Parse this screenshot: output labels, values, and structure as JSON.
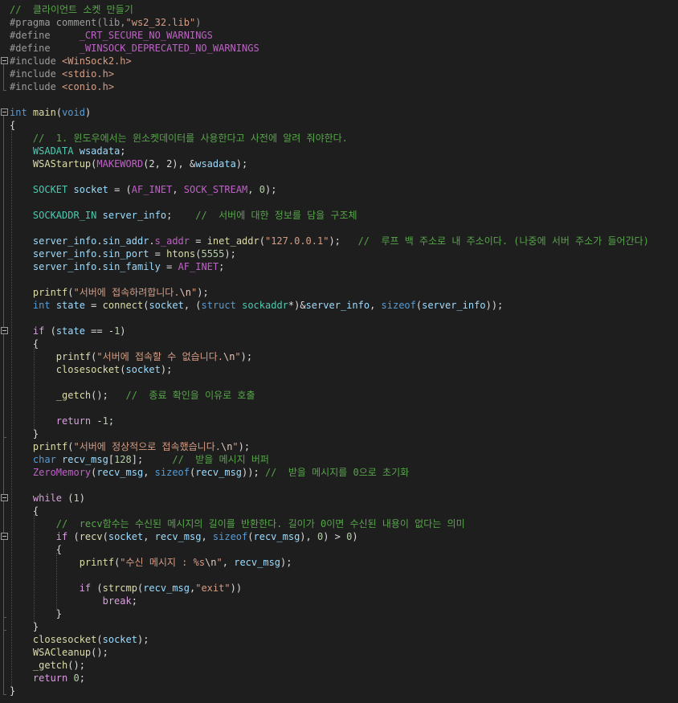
{
  "editor": {
    "theme_colors": {
      "background": "#1e1e1e",
      "comment": "#57a64a",
      "preprocessor": "#9b9b9b",
      "macro": "#bd63c5",
      "string": "#d69d85",
      "keyword": "#569cd6",
      "control": "#d8a0df",
      "type": "#4ec9b0",
      "function": "#dcdcaa",
      "variable": "#9cdcfe",
      "number": "#b5cea8",
      "plain": "#dcdcdc"
    },
    "lines": [
      {
        "tokens": [
          [
            "comment",
            "//  클라이언트 소켓 만들기"
          ]
        ]
      },
      {
        "tokens": [
          [
            "pre",
            "#pragma comment(lib,"
          ],
          [
            "string",
            "\"ws2_32.lib\""
          ],
          [
            "pre",
            ")"
          ]
        ]
      },
      {
        "tokens": [
          [
            "pre",
            "#define     "
          ],
          [
            "macro",
            "_CRT_SECURE_NO_WARNINGS"
          ]
        ]
      },
      {
        "tokens": [
          [
            "pre",
            "#define     "
          ],
          [
            "macro",
            "_WINSOCK_DEPRECATED_NO_WARNINGS"
          ]
        ]
      },
      {
        "tokens": [
          [
            "pre",
            "#include "
          ],
          [
            "string",
            "<WinSock2.h>"
          ]
        ]
      },
      {
        "tokens": [
          [
            "pre",
            "#include "
          ],
          [
            "string",
            "<stdio.h>"
          ]
        ]
      },
      {
        "tokens": [
          [
            "pre",
            "#include "
          ],
          [
            "string",
            "<conio.h>"
          ]
        ]
      },
      {
        "tokens": []
      },
      {
        "tokens": [
          [
            "keyword",
            "int"
          ],
          [
            "plain",
            " "
          ],
          [
            "func",
            "main"
          ],
          [
            "plain",
            "("
          ],
          [
            "keyword",
            "void"
          ],
          [
            "plain",
            ")"
          ]
        ]
      },
      {
        "tokens": [
          [
            "plain",
            "{"
          ]
        ]
      },
      {
        "tokens": [
          [
            "plain",
            "    "
          ],
          [
            "comment",
            "//  1. 윈도우에서는 윈소켓데이터를 사용한다고 사전에 알려 줘야한다."
          ]
        ]
      },
      {
        "tokens": [
          [
            "plain",
            "    "
          ],
          [
            "type",
            "WSADATA"
          ],
          [
            "plain",
            " "
          ],
          [
            "var",
            "wsadata"
          ],
          [
            "plain",
            ";"
          ]
        ]
      },
      {
        "tokens": [
          [
            "plain",
            "    "
          ],
          [
            "func",
            "WSAStartup"
          ],
          [
            "plain",
            "("
          ],
          [
            "macro",
            "MAKEWORD"
          ],
          [
            "plain",
            "(2, 2), &"
          ],
          [
            "var",
            "wsadata"
          ],
          [
            "plain",
            ");"
          ]
        ]
      },
      {
        "tokens": []
      },
      {
        "tokens": [
          [
            "plain",
            "    "
          ],
          [
            "type",
            "SOCKET"
          ],
          [
            "plain",
            " "
          ],
          [
            "var",
            "socket"
          ],
          [
            "plain",
            " = ("
          ],
          [
            "macro",
            "AF_INET"
          ],
          [
            "plain",
            ", "
          ],
          [
            "macro",
            "SOCK_STREAM"
          ],
          [
            "plain",
            ", "
          ],
          [
            "num",
            "0"
          ],
          [
            "plain",
            ");"
          ]
        ]
      },
      {
        "tokens": []
      },
      {
        "tokens": [
          [
            "plain",
            "    "
          ],
          [
            "type",
            "SOCKADDR_IN"
          ],
          [
            "plain",
            " "
          ],
          [
            "var",
            "server_info"
          ],
          [
            "plain",
            ";    "
          ],
          [
            "comment",
            "//  서버에 대한 정보를 담을 구조체"
          ]
        ]
      },
      {
        "tokens": []
      },
      {
        "tokens": [
          [
            "plain",
            "    "
          ],
          [
            "var",
            "server_info"
          ],
          [
            "plain",
            "."
          ],
          [
            "var",
            "sin_addr"
          ],
          [
            "plain",
            "."
          ],
          [
            "macro",
            "s_addr"
          ],
          [
            "plain",
            " = "
          ],
          [
            "func",
            "inet_addr"
          ],
          [
            "plain",
            "("
          ],
          [
            "string",
            "\"127.0.0.1\""
          ],
          [
            "plain",
            ");   "
          ],
          [
            "comment",
            "//  루프 백 주소로 내 주소이다. (나중에 서버 주소가 들어간다)"
          ]
        ]
      },
      {
        "tokens": [
          [
            "plain",
            "    "
          ],
          [
            "var",
            "server_info"
          ],
          [
            "plain",
            "."
          ],
          [
            "var",
            "sin_port"
          ],
          [
            "plain",
            " = "
          ],
          [
            "func",
            "htons"
          ],
          [
            "plain",
            "("
          ],
          [
            "num",
            "5555"
          ],
          [
            "plain",
            ");"
          ]
        ]
      },
      {
        "tokens": [
          [
            "plain",
            "    "
          ],
          [
            "var",
            "server_info"
          ],
          [
            "plain",
            "."
          ],
          [
            "var",
            "sin_family"
          ],
          [
            "plain",
            " = "
          ],
          [
            "macro",
            "AF_INET"
          ],
          [
            "plain",
            ";"
          ]
        ]
      },
      {
        "tokens": []
      },
      {
        "tokens": [
          [
            "plain",
            "    "
          ],
          [
            "func",
            "printf"
          ],
          [
            "plain",
            "("
          ],
          [
            "string",
            "\"서버에 접속하려합니다."
          ],
          [
            "esc",
            "\\n"
          ],
          [
            "string",
            "\""
          ],
          [
            "plain",
            ");"
          ]
        ]
      },
      {
        "tokens": [
          [
            "plain",
            "    "
          ],
          [
            "keyword",
            "int"
          ],
          [
            "plain",
            " "
          ],
          [
            "var",
            "state"
          ],
          [
            "plain",
            " = "
          ],
          [
            "func",
            "connect"
          ],
          [
            "plain",
            "("
          ],
          [
            "var",
            "socket"
          ],
          [
            "plain",
            ", ("
          ],
          [
            "keyword",
            "struct"
          ],
          [
            "plain",
            " "
          ],
          [
            "type",
            "sockaddr"
          ],
          [
            "plain",
            "*)&"
          ],
          [
            "var",
            "server_info"
          ],
          [
            "plain",
            ", "
          ],
          [
            "keyword",
            "sizeof"
          ],
          [
            "plain",
            "("
          ],
          [
            "var",
            "server_info"
          ],
          [
            "plain",
            "));"
          ]
        ]
      },
      {
        "tokens": []
      },
      {
        "tokens": [
          [
            "plain",
            "    "
          ],
          [
            "ctrl",
            "if"
          ],
          [
            "plain",
            " ("
          ],
          [
            "var",
            "state"
          ],
          [
            "plain",
            " == -"
          ],
          [
            "num",
            "1"
          ],
          [
            "plain",
            ")"
          ]
        ]
      },
      {
        "tokens": [
          [
            "plain",
            "    {"
          ]
        ]
      },
      {
        "tokens": [
          [
            "plain",
            "        "
          ],
          [
            "func",
            "printf"
          ],
          [
            "plain",
            "("
          ],
          [
            "string",
            "\"서버에 접속할 수 없습니다."
          ],
          [
            "esc",
            "\\n"
          ],
          [
            "string",
            "\""
          ],
          [
            "plain",
            ");"
          ]
        ]
      },
      {
        "tokens": [
          [
            "plain",
            "        "
          ],
          [
            "func",
            "closesocket"
          ],
          [
            "plain",
            "("
          ],
          [
            "var",
            "socket"
          ],
          [
            "plain",
            ");"
          ]
        ]
      },
      {
        "tokens": []
      },
      {
        "tokens": [
          [
            "plain",
            "        "
          ],
          [
            "func",
            "_getch"
          ],
          [
            "plain",
            "();   "
          ],
          [
            "comment",
            "//  종료 확인을 이유로 호출"
          ]
        ]
      },
      {
        "tokens": []
      },
      {
        "tokens": [
          [
            "plain",
            "        "
          ],
          [
            "ctrl",
            "return"
          ],
          [
            "plain",
            " -"
          ],
          [
            "num",
            "1"
          ],
          [
            "plain",
            ";"
          ]
        ]
      },
      {
        "tokens": [
          [
            "plain",
            "    }"
          ]
        ]
      },
      {
        "tokens": [
          [
            "plain",
            "    "
          ],
          [
            "func",
            "printf"
          ],
          [
            "plain",
            "("
          ],
          [
            "string",
            "\"서버에 정상적으로 접속했습니다."
          ],
          [
            "esc",
            "\\n"
          ],
          [
            "string",
            "\""
          ],
          [
            "plain",
            ");"
          ]
        ]
      },
      {
        "tokens": [
          [
            "plain",
            "    "
          ],
          [
            "keyword",
            "char"
          ],
          [
            "plain",
            " "
          ],
          [
            "var",
            "recv_msg"
          ],
          [
            "plain",
            "["
          ],
          [
            "num",
            "128"
          ],
          [
            "plain",
            "];     "
          ],
          [
            "comment",
            "//  받을 메시지 버퍼"
          ]
        ]
      },
      {
        "tokens": [
          [
            "plain",
            "    "
          ],
          [
            "macro",
            "ZeroMemory"
          ],
          [
            "plain",
            "("
          ],
          [
            "var",
            "recv_msg"
          ],
          [
            "plain",
            ", "
          ],
          [
            "keyword",
            "sizeof"
          ],
          [
            "plain",
            "("
          ],
          [
            "var",
            "recv_msg"
          ],
          [
            "plain",
            ")); "
          ],
          [
            "comment",
            "//  받을 메시지를 0으로 초기화"
          ]
        ]
      },
      {
        "tokens": []
      },
      {
        "tokens": [
          [
            "plain",
            "    "
          ],
          [
            "ctrl",
            "while"
          ],
          [
            "plain",
            " ("
          ],
          [
            "num",
            "1"
          ],
          [
            "plain",
            ")"
          ]
        ]
      },
      {
        "tokens": [
          [
            "plain",
            "    {"
          ]
        ]
      },
      {
        "tokens": [
          [
            "plain",
            "        "
          ],
          [
            "comment",
            "//  recv함수는 수신된 메시지의 길이를 반환한다. 길이가 0이면 수신된 내용이 없다는 의미"
          ]
        ]
      },
      {
        "tokens": [
          [
            "plain",
            "        "
          ],
          [
            "ctrl",
            "if"
          ],
          [
            "plain",
            " ("
          ],
          [
            "func",
            "recv"
          ],
          [
            "plain",
            "("
          ],
          [
            "var",
            "socket"
          ],
          [
            "plain",
            ", "
          ],
          [
            "var",
            "recv_msg"
          ],
          [
            "plain",
            ", "
          ],
          [
            "keyword",
            "sizeof"
          ],
          [
            "plain",
            "("
          ],
          [
            "var",
            "recv_msg"
          ],
          [
            "plain",
            "), "
          ],
          [
            "num",
            "0"
          ],
          [
            "plain",
            ") > "
          ],
          [
            "num",
            "0"
          ],
          [
            "plain",
            ")"
          ]
        ]
      },
      {
        "tokens": [
          [
            "plain",
            "        {"
          ]
        ]
      },
      {
        "tokens": [
          [
            "plain",
            "            "
          ],
          [
            "func",
            "printf"
          ],
          [
            "plain",
            "("
          ],
          [
            "string",
            "\"수신 메시지 : %s"
          ],
          [
            "esc",
            "\\n"
          ],
          [
            "string",
            "\""
          ],
          [
            "plain",
            ", "
          ],
          [
            "var",
            "recv_msg"
          ],
          [
            "plain",
            ");"
          ]
        ]
      },
      {
        "tokens": []
      },
      {
        "tokens": [
          [
            "plain",
            "            "
          ],
          [
            "ctrl",
            "if"
          ],
          [
            "plain",
            " ("
          ],
          [
            "func",
            "strcmp"
          ],
          [
            "plain",
            "("
          ],
          [
            "var",
            "recv_msg"
          ],
          [
            "plain",
            ","
          ],
          [
            "string",
            "\"exit\""
          ],
          [
            "plain",
            "))"
          ]
        ]
      },
      {
        "tokens": [
          [
            "plain",
            "                "
          ],
          [
            "ctrl",
            "break"
          ],
          [
            "plain",
            ";"
          ]
        ]
      },
      {
        "tokens": [
          [
            "plain",
            "        }"
          ]
        ]
      },
      {
        "tokens": [
          [
            "plain",
            "    }"
          ]
        ]
      },
      {
        "tokens": [
          [
            "plain",
            "    "
          ],
          [
            "func",
            "closesocket"
          ],
          [
            "plain",
            "("
          ],
          [
            "var",
            "socket"
          ],
          [
            "plain",
            ");"
          ]
        ]
      },
      {
        "tokens": [
          [
            "plain",
            "    "
          ],
          [
            "func",
            "WSACleanup"
          ],
          [
            "plain",
            "();"
          ]
        ]
      },
      {
        "tokens": [
          [
            "plain",
            "    "
          ],
          [
            "func",
            "_getch"
          ],
          [
            "plain",
            "();"
          ]
        ]
      },
      {
        "tokens": [
          [
            "plain",
            "    "
          ],
          [
            "ctrl",
            "return"
          ],
          [
            "plain",
            " "
          ],
          [
            "num",
            "0"
          ],
          [
            "plain",
            ";"
          ]
        ]
      },
      {
        "tokens": [
          [
            "plain",
            "}"
          ]
        ]
      }
    ]
  }
}
